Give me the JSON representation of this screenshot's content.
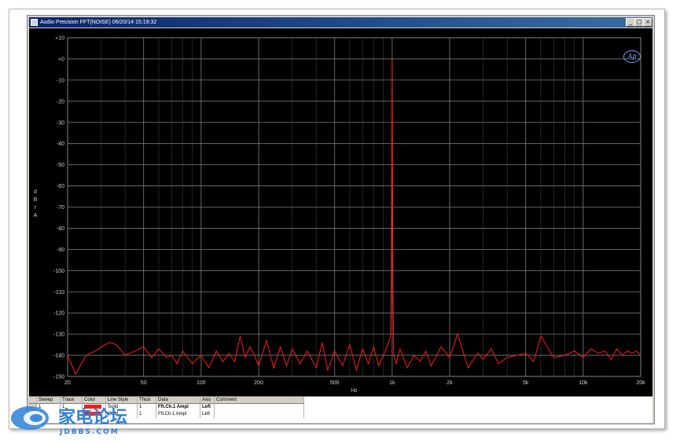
{
  "window": {
    "title": "Audio Precision  FFT(NOISE)  06/20/14 15:19:32",
    "buttons": [
      "_",
      "□",
      "×"
    ]
  },
  "colors": {
    "trace": "#ff1a1a",
    "grid": "#7a7a7a",
    "plot_bg": "#000000",
    "axis_text": "#d0d0d0"
  },
  "chart_data": {
    "type": "line",
    "title": "",
    "xlabel": "Hz",
    "ylabel": "dBrA",
    "xscale": "log",
    "xlim": [
      20,
      20000
    ],
    "ylim": [
      -150,
      10
    ],
    "xticks": [
      "20",
      "50",
      "100",
      "200",
      "500",
      "1k",
      "2k",
      "5k",
      "10k",
      "20k"
    ],
    "xtick_values": [
      20,
      50,
      100,
      200,
      500,
      1000,
      2000,
      5000,
      10000,
      20000
    ],
    "yticks": [
      "+10",
      "+0",
      "-10",
      "-20",
      "-30",
      "-40",
      "-50",
      "-60",
      "-70",
      "-80",
      "-90",
      "-100",
      "-110",
      "-120",
      "-130",
      "-140",
      "-150"
    ],
    "ytick_values": [
      10,
      0,
      -10,
      -20,
      -30,
      -40,
      -50,
      -60,
      -70,
      -80,
      -90,
      -100,
      -110,
      -120,
      -130,
      -140,
      -150
    ],
    "grid": true,
    "series": [
      {
        "color": "#ff1a1a",
        "x": [
          20,
          22,
          25,
          28,
          30,
          33,
          36,
          40,
          45,
          50,
          55,
          60,
          66,
          70,
          75,
          80,
          90,
          100,
          110,
          120,
          130,
          140,
          150,
          160,
          170,
          180,
          190,
          200,
          220,
          240,
          260,
          280,
          300,
          330,
          360,
          400,
          430,
          460,
          500,
          550,
          600,
          650,
          700,
          750,
          800,
          850,
          900,
          950,
          980,
          990,
          1000,
          1010,
          1020,
          1050,
          1100,
          1200,
          1300,
          1400,
          1500,
          1600,
          1800,
          2000,
          2200,
          2500,
          2800,
          3000,
          3300,
          3600,
          4000,
          4500,
          5000,
          5500,
          6000,
          7000,
          8000,
          9000,
          10000,
          11000,
          12000,
          13000,
          14000,
          15000,
          16000,
          17000,
          18000,
          19000,
          20000
        ],
        "y": [
          -140,
          -149,
          -140,
          -138,
          -136,
          -134,
          -135,
          -140,
          -138,
          -136,
          -141,
          -137,
          -141,
          -140,
          -144,
          -138,
          -144,
          -140,
          -146,
          -138,
          -143,
          -139,
          -143,
          -131,
          -141,
          -136,
          -140,
          -145,
          -133,
          -146,
          -136,
          -145,
          -137,
          -144,
          -138,
          -146,
          -134,
          -147,
          -138,
          -145,
          -135,
          -147,
          -137,
          -144,
          -136,
          -145,
          -140,
          -135,
          -131,
          -100,
          0,
          -110,
          -140,
          -144,
          -137,
          -146,
          -140,
          -143,
          -138,
          -145,
          -136,
          -141,
          -130,
          -146,
          -139,
          -142,
          -137,
          -144,
          -141,
          -140,
          -139,
          -143,
          -131,
          -141,
          -140,
          -138,
          -141,
          -137,
          -139,
          -138,
          -142,
          -137,
          -140,
          -138,
          -139,
          -138,
          -140
        ]
      }
    ]
  },
  "table": {
    "columns": [
      "Sweep",
      "Trace",
      "Color",
      "Line Style",
      "Thick",
      "Data",
      "Axis",
      "Comment"
    ],
    "rows": [
      {
        "sweep": "1",
        "trace": "1",
        "color": "",
        "style": "Solid",
        "thick": "1",
        "data": "Fft.Ch.1 Ampl",
        "axis": "Left",
        "comment": ""
      },
      {
        "sweep": "2",
        "trace": "1",
        "color": "",
        "style": "Solid",
        "thick": "1",
        "data": "Fft.Ch.1 Ampl",
        "axis": "Left",
        "comment": ""
      }
    ]
  },
  "watermark": {
    "brand": "家电论坛",
    "site": "JDBBS.COM"
  }
}
